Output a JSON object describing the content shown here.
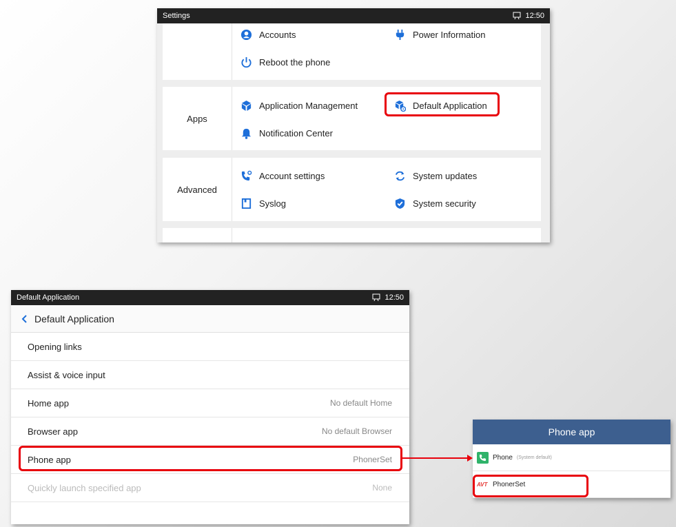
{
  "settings": {
    "status_title": "Settings",
    "time": "12:50",
    "group_top": {
      "items": [
        {
          "label": "Accounts",
          "icon": "account-circle-icon"
        },
        {
          "label": "Power Information",
          "icon": "power-plug-icon"
        },
        {
          "label": "Reboot the phone",
          "icon": "power-icon"
        }
      ]
    },
    "group_apps": {
      "label": "Apps",
      "items": [
        {
          "label": "Application Management",
          "icon": "app-cube-icon"
        },
        {
          "label": "Default Application",
          "icon": "default-app-icon"
        },
        {
          "label": "Notification Center",
          "icon": "bell-icon"
        }
      ]
    },
    "group_advanced": {
      "label": "Advanced",
      "items": [
        {
          "label": "Account settings",
          "icon": "phone-settings-icon"
        },
        {
          "label": "System updates",
          "icon": "refresh-icon"
        },
        {
          "label": "Syslog",
          "icon": "document-icon"
        },
        {
          "label": "System security",
          "icon": "shield-check-icon"
        }
      ]
    }
  },
  "default_app": {
    "status_title": "Default Application",
    "time": "12:50",
    "nav_title": "Default Application",
    "rows": [
      {
        "label": "Opening links",
        "value": ""
      },
      {
        "label": "Assist & voice input",
        "value": ""
      },
      {
        "label": "Home app",
        "value": "No default Home"
      },
      {
        "label": "Browser app",
        "value": "No default Browser"
      },
      {
        "label": "Phone app",
        "value": "PhonerSet"
      },
      {
        "label": "Quickly launch specified app",
        "value": "None"
      }
    ]
  },
  "phone_dialog": {
    "title": "Phone app",
    "options": [
      {
        "name": "Phone",
        "note": "(System default)",
        "icon": "phone-icon"
      },
      {
        "name": "PhonerSet",
        "note": "",
        "icon": "avt-logo",
        "logo_text": "AVT"
      }
    ]
  },
  "colors": {
    "highlight": "#e8000b",
    "icon_blue": "#1e6fd9",
    "dialog_header": "#3d5f8f",
    "status_bar": "#222222"
  }
}
